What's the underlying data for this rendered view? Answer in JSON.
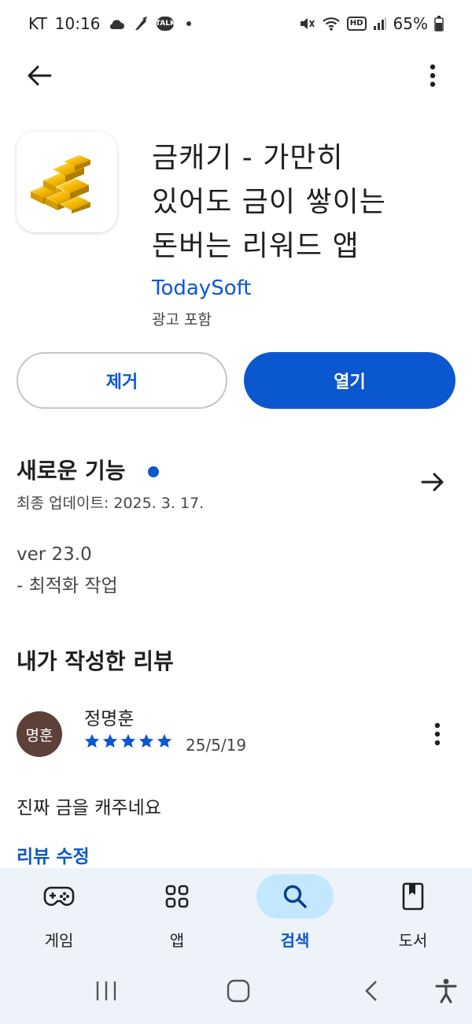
{
  "status_bar": {
    "carrier": "KT",
    "time": "10:16",
    "talk_badge": "TALK",
    "hd_badge": "HD",
    "battery": "65%"
  },
  "app": {
    "title_line1": "금캐기 - 가만히",
    "title_line2": "있어도 금이 쌓이는",
    "title_line3": "돈버는 리워드 앱",
    "developer": "TodaySoft",
    "ads_note": "광고 포함"
  },
  "actions": {
    "remove_label": "제거",
    "open_label": "열기"
  },
  "whats_new": {
    "title": "새로운 기능",
    "last_updated": "최종 업데이트: 2025. 3. 17.",
    "version": "ver 23.0",
    "note": "- 최적화 작업"
  },
  "my_review": {
    "section_title": "내가 작성한 리뷰",
    "avatar_text": "명훈",
    "reviewer_name": "정명훈",
    "rating": 5,
    "date": "25/5/19",
    "text": "진짜 금을 캐주네요",
    "edit_label": "리뷰 수정"
  },
  "bottom_nav": {
    "items": [
      {
        "label": "게임",
        "icon": "gamepad-icon"
      },
      {
        "label": "앱",
        "icon": "apps-grid-icon"
      },
      {
        "label": "검색",
        "icon": "search-icon"
      },
      {
        "label": "도서",
        "icon": "book-icon"
      }
    ],
    "active": "검색"
  },
  "colors": {
    "accent": "#0b57d0",
    "active_pill": "#c2e7ff",
    "nav_bg": "#eef3f9",
    "avatar_bg": "#5d4037"
  }
}
